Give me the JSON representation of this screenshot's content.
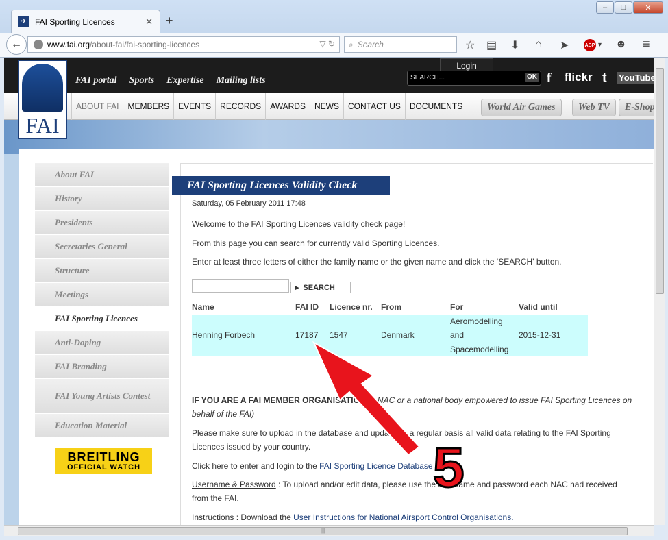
{
  "browser": {
    "tab_title": "FAI Sporting Licences",
    "url_domain": "www.fai.org",
    "url_path": "/about-fai/fai-sporting-licences",
    "search_placeholder": "Search",
    "window_controls": [
      "–",
      "□",
      "✕"
    ]
  },
  "site": {
    "logo_text": "FAI",
    "top_nav": [
      "FAI portal",
      "Sports",
      "Expertise",
      "Mailing lists"
    ],
    "search_placeholder": "SEARCH...",
    "search_ok": "OK",
    "login": "Login",
    "social": [
      "f",
      "flickr",
      "t",
      "YouTube"
    ],
    "main_menu": [
      "ABOUT FAI",
      "MEMBERS",
      "EVENTS",
      "RECORDS",
      "AWARDS",
      "NEWS",
      "CONTACT US",
      "DOCUMENTS"
    ],
    "pills": [
      "World Air Games",
      "Web TV",
      "E-Shop"
    ]
  },
  "sidebar": {
    "items": [
      "About FAI",
      "History",
      "Presidents",
      "Secretaries General",
      "Structure",
      "Meetings",
      "FAI Sporting Licences",
      "Anti-Doping",
      "FAI Branding",
      "FAI Young Artists Contest",
      "Education Material"
    ],
    "active": "FAI Sporting Licences",
    "sponsor_line1": "BREITLING",
    "sponsor_line2": "OFFICIAL WATCH"
  },
  "content": {
    "title": "FAI Sporting Licences Validity Check",
    "date": "Saturday, 05 February 2011 17:48",
    "p1": "Welcome to the FAI Sporting Licences validity check page!",
    "p2": "From this page you can search for currently valid Sporting Licences.",
    "p3": "Enter at least three letters of either the family name or the given name and click the 'SEARCH' button.",
    "search_button": "SEARCH",
    "table_headers": [
      "Name",
      "FAI ID",
      "Licence nr.",
      "From",
      "For",
      "Valid until"
    ],
    "result": {
      "name": "Henning Forbech",
      "fai_id": "17187",
      "licence": "1547",
      "from": "Denmark",
      "for_lines": [
        "Aeromodelling",
        "and",
        "Spacemodelling"
      ],
      "valid_until": "2015-12-31"
    },
    "member_heading_bold": "IF YOU ARE A FAI MEMBER ORGANISATION",
    "member_heading_italic1": " (a NAC or a national body empowered to issue FAI Sporting Licences on",
    "member_heading_italic2": "behalf of the FAI)",
    "p4a": "Please make sure to upload in the database and update on a regular basis all valid data relating to the FAI Sporting",
    "p4b": "Licences issued by your country.",
    "p5_prefix": "Click here to enter and login to the ",
    "p5_link": "FAI Sporting Licence Database",
    "p6_label": "Username & Password",
    "p6a": " : To upload and/or edit data, please use the username and password each NAC had received",
    "p6b": "from the FAI.",
    "p7_label": "Instructions",
    "p7_prefix": " : Download the ",
    "p7_link": "User Instructions for National Airsport Control Organisations."
  },
  "annotation": {
    "number": "5",
    "color": "#e8141c"
  }
}
